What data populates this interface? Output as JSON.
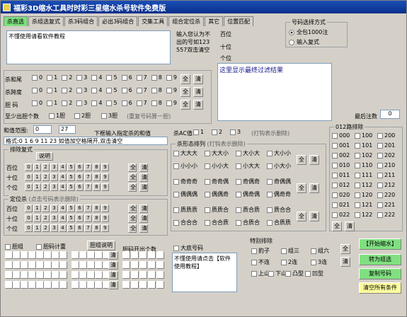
{
  "window": {
    "title": "福彩3D缩水工具时时彩三星缩水杀号软件免费版"
  },
  "tabs": [
    "杀直选",
    "杀组选复式",
    "杀3码组合",
    "必出3码组合",
    "交集工具",
    "组合定位杀",
    "其它",
    "位置匹配"
  ],
  "input": {
    "text": "不懂使用请看软件教程",
    "hint": "输入您认为不出的号如123 557双击清空"
  },
  "positions": [
    "百位",
    "十位",
    "个位"
  ],
  "result": {
    "text": "这里显示最终过滤结果"
  },
  "mode": {
    "title": "号码选择方式",
    "options": [
      "全包1000注",
      "输入复式"
    ]
  },
  "killsum": {
    "rows": [
      "杀和尾",
      "杀跨度",
      "胆 码"
    ],
    "digits": [
      "0",
      "1",
      "2",
      "3",
      "4",
      "5",
      "6",
      "7",
      "8",
      "9"
    ],
    "all": "全",
    "clear": "清"
  },
  "atleast": {
    "label": "至少出胆个数",
    "opts": [
      "1胆",
      "2胆",
      "3胆"
    ],
    "note": "(重复号码算一胆)"
  },
  "remain": {
    "label": "最后注数",
    "value": "0"
  },
  "range": {
    "label": "和值范围:",
    "from": "0",
    "to": "27",
    "hint": "下框输入指定杀的和值",
    "format": "格式:0 1 6 9 11 23 如值加空格隔开,双击清空"
  },
  "ac": {
    "label": "杀AC值:",
    "opts": [
      "1",
      "2",
      "3"
    ],
    "note": "(打钩表示删除)"
  },
  "pattern": {
    "title": "杀形态排列",
    "note": "(打钩表示删除)",
    "g1": [
      [
        "大大大",
        "大大小",
        "大小大",
        "大小小"
      ],
      [
        "小小小",
        "小小大",
        "小大大",
        "小大小"
      ]
    ],
    "g2": [
      [
        "奇奇奇",
        "奇奇偶",
        "奇偶奇",
        "奇偶偶"
      ],
      [
        "偶偶偶",
        "偶偶奇",
        "偶奇偶",
        "偶奇奇"
      ]
    ],
    "g3": [
      [
        "质质质",
        "质质合",
        "质合质",
        "质合合"
      ],
      [
        "合合合",
        "合合质",
        "合质合",
        "合质质"
      ]
    ],
    "all": "全",
    "clear": "清"
  },
  "route": {
    "title": "012路排除",
    "codes": [
      "000",
      "100",
      "200",
      "001",
      "101",
      "201",
      "002",
      "102",
      "202",
      "010",
      "110",
      "210",
      "011",
      "111",
      "211",
      "012",
      "112",
      "212",
      "020",
      "120",
      "220",
      "021",
      "121",
      "221",
      "022",
      "122",
      "222"
    ],
    "all": "全",
    "clear": "清"
  },
  "pairdup": {
    "title": "排除复式",
    "explain": "说明",
    "positions": [
      "百位",
      "十位",
      "个位"
    ],
    "digits": [
      "0",
      "1",
      "2",
      "3",
      "4",
      "5",
      "6",
      "7",
      "8",
      "9"
    ]
  },
  "fixkill": {
    "title": "定位杀",
    "note": "(点击号码表示删除)",
    "positions": [
      "百位",
      "十位",
      "个位"
    ]
  },
  "dan": {
    "labels": [
      "胆组",
      "胆码计重",
      "胆组说明",
      "胆码开出个数"
    ],
    "clearlabel": "清"
  },
  "bigbottom": {
    "title": "大底号码",
    "text": "不懂使用请点击【软件使用教程】"
  },
  "special": {
    "title": "特别排除",
    "items": [
      "豹子",
      "组三",
      "组六",
      "不连",
      "2连",
      "3连",
      "上山",
      "下山",
      "凸型",
      "凹型"
    ],
    "all": "全",
    "clear": "清"
  },
  "actions": {
    "start": "【开始缩水】",
    "toGroup": "转为组选",
    "copy": "复制号码",
    "clearAll": "清空所有条件"
  },
  "colors": {
    "titlebar": "#0a2f8c",
    "tabActive": "#7fe07f",
    "btnGreen": "#80e080",
    "btnYellow": "#ffffa0",
    "resultText": "#1a1a8c"
  }
}
